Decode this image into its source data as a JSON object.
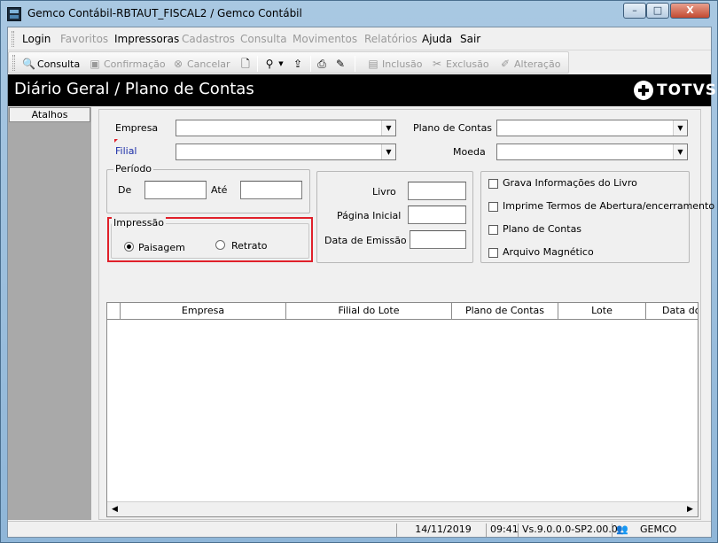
{
  "window": {
    "title": "Gemco Contábil-RBTAUT_FISCAL2 / Gemco Contábil",
    "min_label": "–",
    "max_label": "□",
    "close_label": "X"
  },
  "menu": {
    "items": [
      {
        "label": "Login",
        "enabled": true
      },
      {
        "label": "Favoritos",
        "enabled": false
      },
      {
        "label": "Impressoras",
        "enabled": true
      },
      {
        "label": "Cadastros",
        "enabled": false
      },
      {
        "label": "Consulta",
        "enabled": false
      },
      {
        "label": "Movimentos",
        "enabled": false
      },
      {
        "label": "Relatórios",
        "enabled": false
      },
      {
        "label": "Ajuda",
        "enabled": true
      },
      {
        "label": "Sair",
        "enabled": true
      }
    ]
  },
  "toolbar": {
    "consulta": "Consulta",
    "confirmacao": "Confirmação",
    "cancelar": "Cancelar",
    "inclusao": "Inclusão",
    "exclusao": "Exclusão",
    "alteracao": "Alteração"
  },
  "header": {
    "title": "Diário Geral / Plano de Contas",
    "logo": "TOTVS"
  },
  "sidebar": {
    "tab_label": "Atalhos"
  },
  "form": {
    "empresa_label": "Empresa",
    "empresa_value": "",
    "filial_label": "Filial",
    "filial_value": "",
    "plano_label": "Plano de Contas",
    "plano_value": "",
    "moeda_label": "Moeda",
    "moeda_value": "",
    "periodo": {
      "legend": "Período",
      "de_label": "De",
      "de_value": "",
      "ate_label": "Até",
      "ate_value": ""
    },
    "impressao": {
      "legend": "Impressão",
      "paisagem": "Paisagem",
      "retrato": "Retrato",
      "selected": "Paisagem"
    },
    "livro_label": "Livro",
    "livro_value": "",
    "pagina_label": "Página Inicial",
    "pagina_value": "",
    "data_label": "Data de Emissão",
    "data_value": "",
    "options": [
      {
        "label": "Grava Informações do Livro",
        "checked": false
      },
      {
        "label": "Imprime Termos de Abertura/encerramento",
        "checked": false
      },
      {
        "label": "Plano de Contas",
        "checked": false
      },
      {
        "label": "Arquivo Magnético",
        "checked": false
      }
    ]
  },
  "grid": {
    "columns": [
      "",
      "Empresa",
      "Filial do Lote",
      "Plano de Contas",
      "Lote",
      "Data do"
    ],
    "rows": []
  },
  "status": {
    "date": "14/11/2019",
    "time": "09:41",
    "version": "Vs.9.0.0.0-SP2.00.0",
    "company": "GEMCO"
  },
  "colors": {
    "header_bg": "#000000",
    "highlight_border": "#e0202a",
    "filial_label": "#1c2fa8"
  }
}
